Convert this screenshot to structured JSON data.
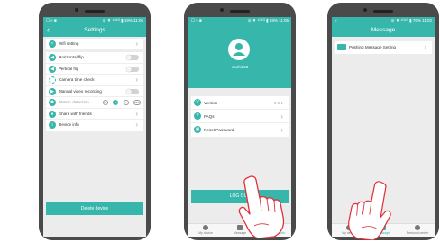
{
  "colors": {
    "accent": "#37b7ab",
    "hand_outline": "#e0303a",
    "frame": "#4a4a4a"
  },
  "phone1": {
    "status_left": "☐ ≈ ■",
    "status_right": "⊘ ▼ ⁴ᴳ⁴ᴳ ▮ 19% 11:05",
    "title": "Settings",
    "items": [
      {
        "label": "Wifi setting",
        "icon": "wifi-icon",
        "control": "chevron"
      },
      {
        "label": "Horizontal flip",
        "icon": "horizontal-flip-icon",
        "control": "toggle"
      },
      {
        "label": "Vertical flip",
        "icon": "vertical-flip-icon",
        "control": "toggle"
      },
      {
        "label": "Camera time check",
        "icon": "clock-icon",
        "control": "chevron"
      },
      {
        "label": "Manual video recording",
        "icon": "video-icon",
        "control": "toggle"
      },
      {
        "label": "Motion detection",
        "icon": "motion-icon",
        "control": "pills"
      },
      {
        "label": "Share with friends",
        "icon": "share-icon",
        "control": "chevron"
      },
      {
        "label": "Device info",
        "icon": "info-icon",
        "control": "chevron"
      }
    ],
    "motion_options": [
      "H",
      "M",
      "L",
      "OFF"
    ],
    "button": "Delete device"
  },
  "phone2": {
    "status_left": "☐ ≈ ■",
    "status_right": "⊘ ▼ ⁴ᴳ⁴ᴳ ▮ 19% 11:05",
    "username": "caohi693",
    "version_label": "Version",
    "version_value": "2.0.1",
    "faqs": "FAQs",
    "reset": "Reset Password",
    "logout": "LOG OUT",
    "tabs": [
      "My device",
      "Message",
      "Personal center"
    ]
  },
  "phone3": {
    "status_left": "≈",
    "status_right": "⊘ ▼ ⁴ᴳ⁴ᴳ ▮ 76% 11:02",
    "title": "Message",
    "item": "Pushing Message Setting",
    "tabs": [
      "My device",
      "Message",
      "Personal center"
    ]
  }
}
